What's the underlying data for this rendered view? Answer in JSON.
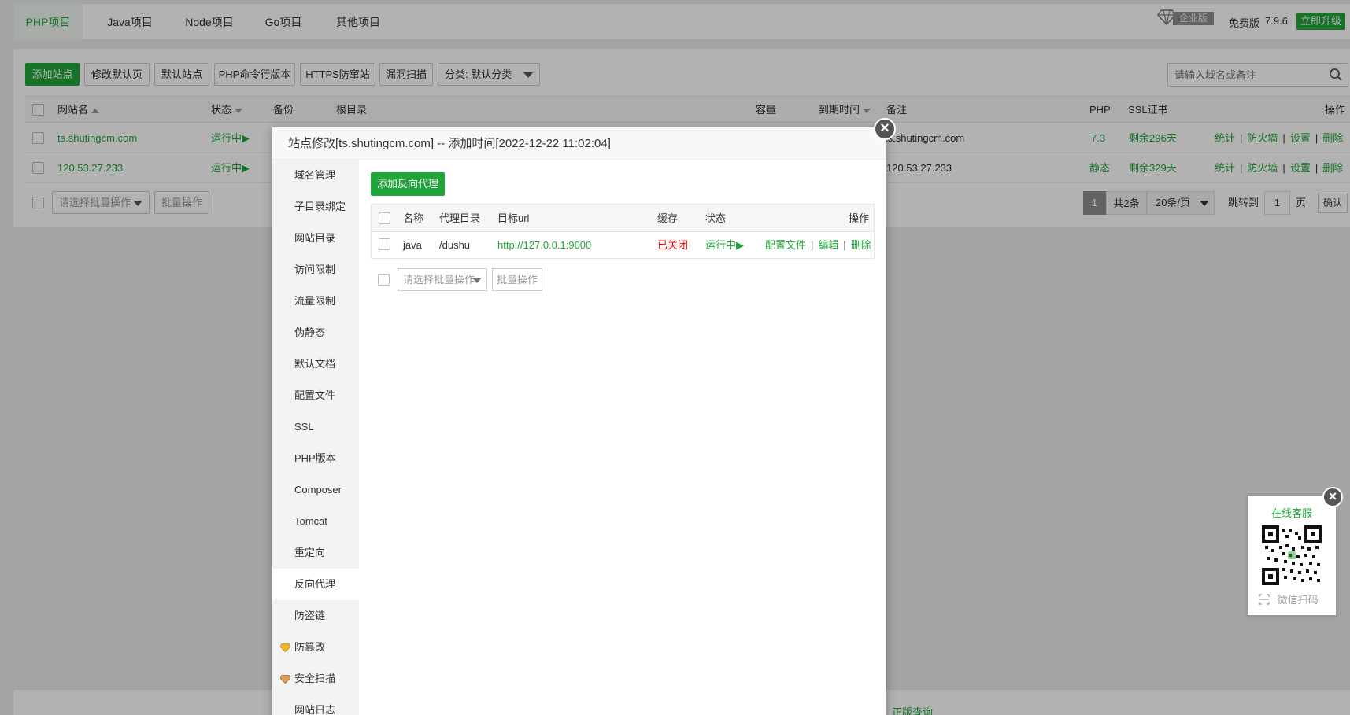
{
  "tabs": [
    {
      "label": "PHP项目",
      "active": true
    },
    {
      "label": "Java项目",
      "active": false
    },
    {
      "label": "Node项目",
      "active": false
    },
    {
      "label": "Go项目",
      "active": false
    },
    {
      "label": "其他项目",
      "active": false
    }
  ],
  "header_right": {
    "enterprise_label": "企业版",
    "free_label": "免费版",
    "version": "7.9.6",
    "upgrade_button": "立即升级"
  },
  "toolbar": {
    "add_site": "添加站点",
    "modify_default_page": "修改默认页",
    "default_site": "默认站点",
    "php_cli_version": "PHP命令行版本",
    "https_guard": "HTTPS防窜站",
    "vuln_scan": "漏洞扫描",
    "category_select": "分类: 默认分类",
    "search_placeholder": "请输入域名或备注"
  },
  "table": {
    "headers": {
      "site_name": "网站名",
      "status": "状态",
      "backup": "备份",
      "root_dir": "根目录",
      "capacity": "容量",
      "expire": "到期时间",
      "note": "备注",
      "php": "PHP",
      "ssl": "SSL证书",
      "actions": "操作"
    },
    "rows": [
      {
        "site_name": "ts.shutingcm.com",
        "status": "运行中▶",
        "note": "ts.shutingcm.com",
        "php": "7.3",
        "ssl": "剩余296天",
        "ops": [
          "统计",
          "防火墙",
          "设置",
          "删除"
        ]
      },
      {
        "site_name": "120.53.27.233",
        "status": "运行中▶",
        "note": "120.53.27.233",
        "php": "静态",
        "ssl": "剩余329天",
        "ops": [
          "统计",
          "防火墙",
          "设置",
          "删除"
        ]
      }
    ],
    "batch_select_placeholder": "请选择批量操作",
    "batch_button": "批量操作"
  },
  "pager": {
    "current_page": "1",
    "total": "共2条",
    "page_size": "20条/页",
    "jump_label": "跳转到",
    "jump_value": "1",
    "page_unit": "页",
    "confirm": "确认"
  },
  "footer": {
    "link": "正版查询"
  },
  "dialog": {
    "title": "站点修改[ts.shutingcm.com] -- 添加时间[2022-12-22 11:02:04]",
    "menu": [
      {
        "label": "域名管理",
        "active": false,
        "pro": false
      },
      {
        "label": "子目录绑定",
        "active": false,
        "pro": false
      },
      {
        "label": "网站目录",
        "active": false,
        "pro": false
      },
      {
        "label": "访问限制",
        "active": false,
        "pro": false
      },
      {
        "label": "流量限制",
        "active": false,
        "pro": false
      },
      {
        "label": "伪静态",
        "active": false,
        "pro": false
      },
      {
        "label": "默认文档",
        "active": false,
        "pro": false
      },
      {
        "label": "配置文件",
        "active": false,
        "pro": false
      },
      {
        "label": "SSL",
        "active": false,
        "pro": false
      },
      {
        "label": "PHP版本",
        "active": false,
        "pro": false
      },
      {
        "label": "Composer",
        "active": false,
        "pro": false
      },
      {
        "label": "Tomcat",
        "active": false,
        "pro": false
      },
      {
        "label": "重定向",
        "active": false,
        "pro": false
      },
      {
        "label": "反向代理",
        "active": true,
        "pro": false
      },
      {
        "label": "防盗链",
        "active": false,
        "pro": false
      },
      {
        "label": "防篡改",
        "active": false,
        "pro": true
      },
      {
        "label": "安全扫描",
        "active": false,
        "pro": true
      },
      {
        "label": "网站日志",
        "active": false,
        "pro": false
      }
    ],
    "add_proxy_button": "添加反向代理",
    "proxy_table": {
      "headers": {
        "name": "名称",
        "proxy_dir": "代理目录",
        "target_url": "目标url",
        "cache": "缓存",
        "status": "状态",
        "actions": "操作"
      },
      "rows": [
        {
          "name": "java",
          "proxy_dir": "/dushu",
          "target_url": "http://127.0.0.1:9000",
          "cache": "已关闭",
          "status": "运行中▶",
          "ops": [
            "配置文件",
            "编辑",
            "删除"
          ]
        }
      ]
    },
    "batch_select_placeholder": "请选择批量操作",
    "batch_button": "批量操作"
  },
  "customer_service": {
    "title": "在线客服",
    "scan_label": "微信扫码"
  },
  "colors": {
    "brand_green": "#20a53a",
    "danger_red": "#ef0808",
    "overlay": "rgba(0,0,0,0.30)"
  }
}
